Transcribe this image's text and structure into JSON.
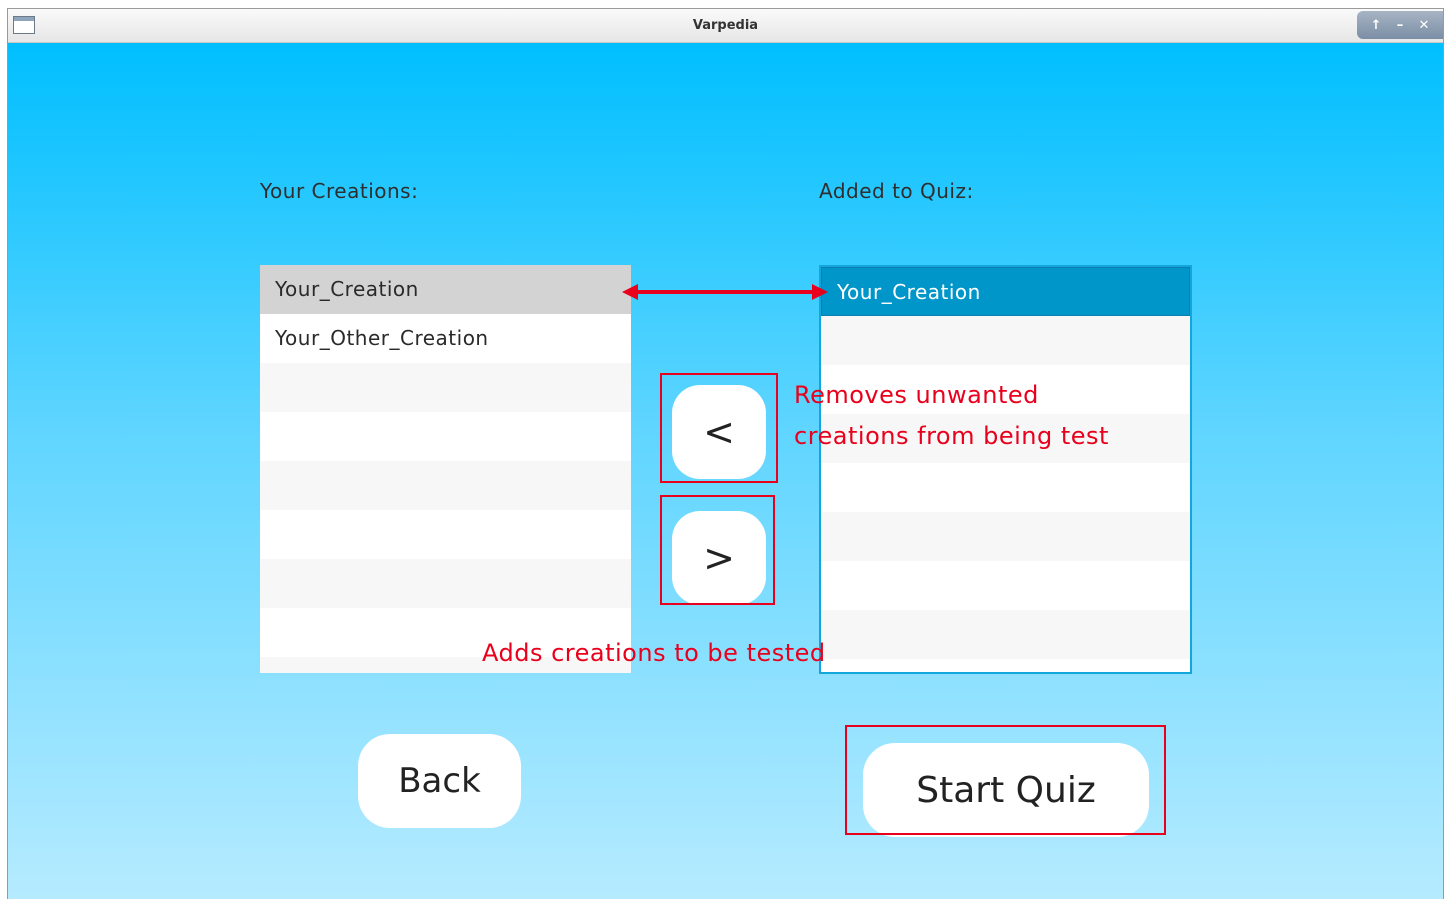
{
  "window": {
    "title": "Varpedia"
  },
  "labels": {
    "your_creations": "Your Creations:",
    "added_to_quiz": "Added to Quiz:"
  },
  "left_list": {
    "items": [
      "Your_Creation",
      "Your_Other_Creation"
    ],
    "selected_index": 0
  },
  "right_list": {
    "items": [
      "Your_Creation"
    ],
    "selected_index": 0
  },
  "buttons": {
    "remove": "<",
    "add": ">",
    "back": "Back",
    "start_quiz": "Start Quiz"
  },
  "annotations": {
    "remove_note": "Removes unwanted creations from being test",
    "add_note": "Adds creations to be tested"
  },
  "colors": {
    "background_top": "#00bfff",
    "background_bottom": "#b6ebff",
    "annotation": "#e8001c",
    "selection_blue": "#0096c9",
    "selection_grey": "#d3d3d3"
  },
  "icons": {
    "window_icon": "app-window-icon",
    "maximize": "arrow-up-icon",
    "minimize": "minimize-icon",
    "close": "close-icon",
    "link_arrow": "double-arrow-icon"
  }
}
